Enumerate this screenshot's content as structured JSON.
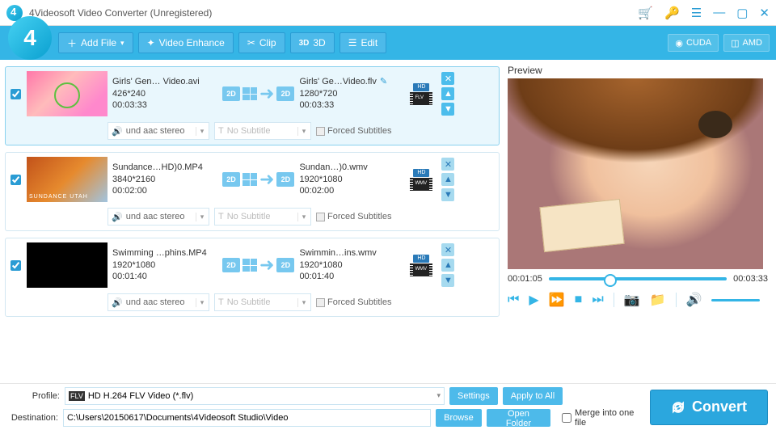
{
  "title": "4Videosoft Video Converter (Unregistered)",
  "toolbar": {
    "add_file": "Add File",
    "video_enhance": "Video Enhance",
    "clip": "Clip",
    "three_d": "3D",
    "edit": "Edit",
    "cuda": "CUDA",
    "amd": "AMD"
  },
  "files": [
    {
      "checked": true,
      "src_name": "Girls' Gen… Video.avi",
      "src_res": "426*240",
      "src_dur": "00:03:33",
      "dst_name": "Girls' Ge…Video.flv",
      "dst_res": "1280*720",
      "dst_dur": "00:03:33",
      "fmt_top": "HD",
      "fmt_label": "FLV",
      "audio": "und aac stereo",
      "sub": "No Subtitle",
      "forced": "Forced Subtitles"
    },
    {
      "checked": true,
      "src_name": "Sundance…HD)0.MP4",
      "src_res": "3840*2160",
      "src_dur": "00:02:00",
      "dst_name": "Sundan…)0.wmv",
      "dst_res": "1920*1080",
      "dst_dur": "00:02:00",
      "fmt_top": "HD",
      "fmt_label": "WMV",
      "audio": "und aac stereo",
      "sub": "No Subtitle",
      "forced": "Forced Subtitles"
    },
    {
      "checked": true,
      "src_name": "Swimming …phins.MP4",
      "src_res": "1920*1080",
      "src_dur": "00:01:40",
      "dst_name": "Swimmin…ins.wmv",
      "dst_res": "1920*1080",
      "dst_dur": "00:01:40",
      "fmt_top": "HD",
      "fmt_label": "WMV",
      "audio": "und aac stereo",
      "sub": "No Subtitle",
      "forced": "Forced Subtitles"
    }
  ],
  "preview": {
    "label": "Preview",
    "time_cur": "00:01:05",
    "time_tot": "00:03:33"
  },
  "bottom": {
    "profile_label": "Profile:",
    "profile_value": "HD H.264 FLV Video (*.flv)",
    "settings": "Settings",
    "apply_all": "Apply to All",
    "dest_label": "Destination:",
    "dest_value": "C:\\Users\\20150617\\Documents\\4Videosoft Studio\\Video",
    "browse": "Browse",
    "open_folder": "Open Folder",
    "merge": "Merge into one file",
    "convert": "Convert"
  }
}
